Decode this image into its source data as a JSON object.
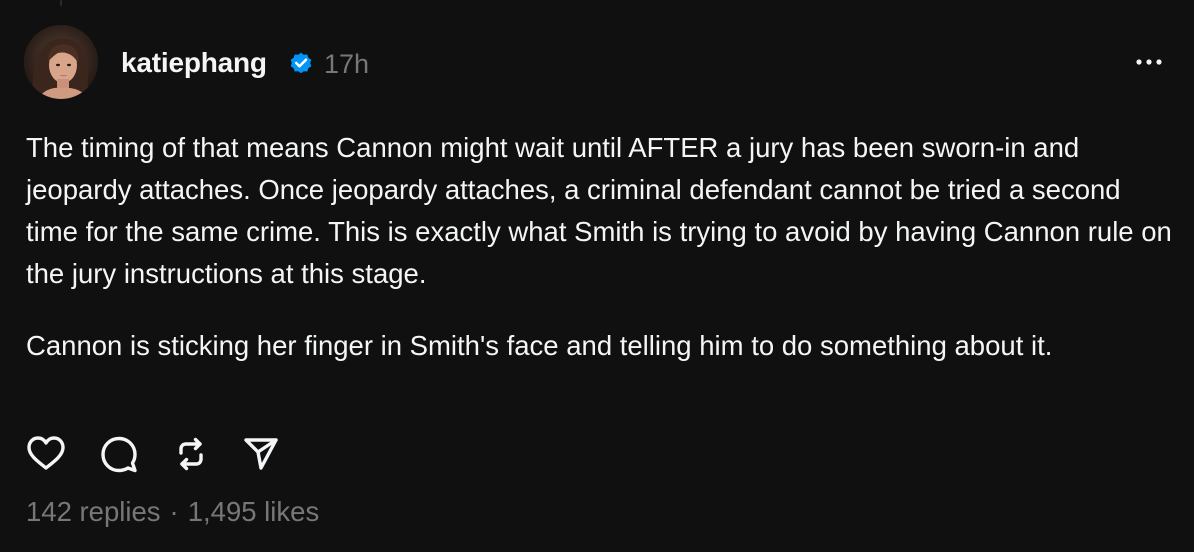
{
  "post": {
    "author": {
      "username": "katiephang",
      "verified": true,
      "verified_icon": "verified-badge-icon",
      "verified_color": "#0095f6"
    },
    "timestamp": "17h",
    "paragraphs": [
      "The timing of that means Cannon might wait until AFTER a jury has been sworn-in and jeopardy attaches. Once jeopardy attaches, a criminal defendant cannot be tried a second time for the same crime. This is exactly what Smith is trying to avoid by having Cannon rule on the jury instructions at this stage.",
      "Cannon is sticking her finger in Smith's face and telling him to do something about it."
    ],
    "actions": {
      "like_icon": "heart-icon",
      "reply_icon": "comment-icon",
      "repost_icon": "repost-icon",
      "share_icon": "send-icon"
    },
    "stats": {
      "replies": "142 replies",
      "separator": "·",
      "likes": "1,495 likes"
    }
  },
  "theme": {
    "background": "#101010",
    "text_primary": "#f3f5f7",
    "text_secondary": "#777777"
  }
}
